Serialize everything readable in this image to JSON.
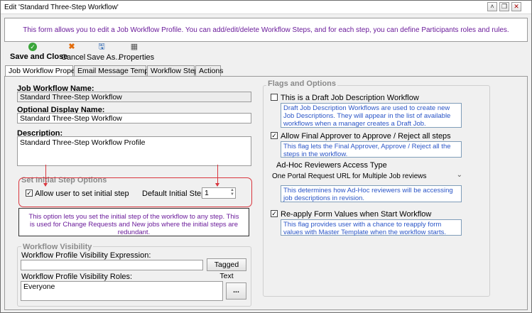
{
  "window": {
    "title": "Edit 'Standard Three-Step Workflow'",
    "controls": [
      "chevron-up-icon",
      "restore-icon",
      "close-icon"
    ]
  },
  "instructions": "This form allows you to edit a Job Workflow Profile. You can add/edit/delete Workflow Steps, and for each step, you can define Participants roles and rules.",
  "toolbar": {
    "save_close": "Save and Close",
    "cancel": "Cancel",
    "save_as": "Save As...",
    "properties": "Properties"
  },
  "tabs": [
    "Job Workflow Properties",
    "Email Message Template",
    "Workflow Steps",
    "Actions"
  ],
  "left": {
    "workflow_name_label": "Job Workflow Name:",
    "workflow_name_value": "Standard Three-Step Workflow",
    "display_name_label": "Optional Display Name:",
    "display_name_value": "Standard Three-Step Workflow",
    "description_label": "Description:",
    "description_value": "Standard Three-Step Workflow Profile",
    "initial_step": {
      "group_title": "Set Initial Step Options",
      "allow_label": "Allow user to set initial step",
      "allow_checked": true,
      "default_label": "Default Initial Step #:",
      "default_value": "1"
    },
    "initial_step_info": "This option lets you set the initial step of the workflow to any step. This is used for Change Requests and New jobs where the initial steps are redundant.",
    "visibility": {
      "group_title": "Workflow Visibility",
      "expression_label": "Workflow Profile Visibility Expression:",
      "expression_value": "",
      "tagged_text_button": "Tagged Text",
      "roles_label": "Workflow Profile Visibility Roles:",
      "roles_value": "Everyone",
      "ellipsis_button": "..."
    }
  },
  "right": {
    "group_title": "Flags and Options",
    "draft_label": "This is a Draft Job Description Workflow",
    "draft_checked": false,
    "draft_info": "Draft Job Description Workflows are used to create new Job Descriptions. They will appear in the list of available workflows when a manager creates a Draft Job.",
    "final_approver_label": "Allow Final Approver to Approve / Reject all steps",
    "final_approver_checked": true,
    "final_approver_info": "This flag lets the Final Approver, Approve / Reject all the steps in the workflow.",
    "adhoc_label": "Ad-Hoc Reviewers Access Type",
    "adhoc_value": "One Portal Request URL for Multiple Job reviews",
    "adhoc_info": "This determines how Ad-Hoc reviewers will be accessing job descriptions in revision.",
    "reapply_label": "Re-apply Form Values when Start Workflow",
    "reapply_checked": true,
    "reapply_info": "This flag provides user with a chance to reapply form values with Master Template when the workflow starts."
  },
  "colors": {
    "instructions_text": "#6a1b9a",
    "info_text": "#2a55c7",
    "highlight": "#d9363e"
  }
}
